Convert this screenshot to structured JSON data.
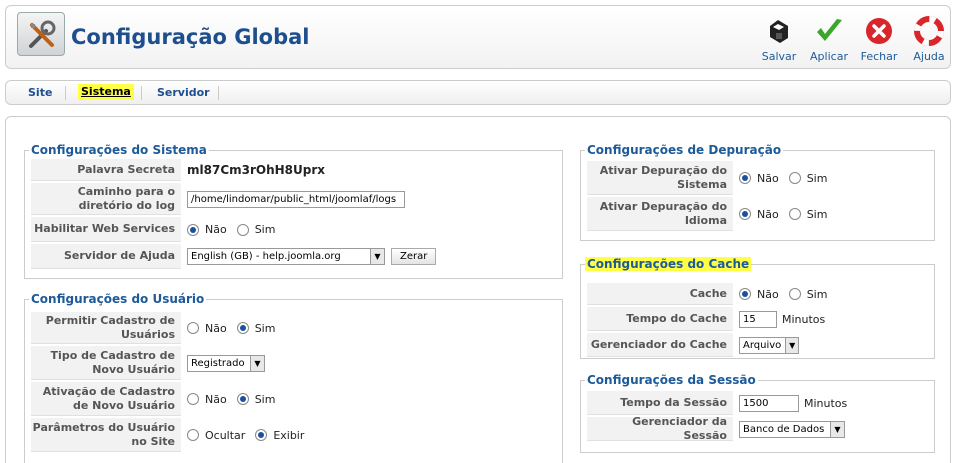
{
  "header": {
    "title": "Configuração Global",
    "toolbar": [
      {
        "label": "Salvar",
        "icon": "save-icon"
      },
      {
        "label": "Aplicar",
        "icon": "apply-check-icon"
      },
      {
        "label": "Fechar",
        "icon": "close-icon"
      },
      {
        "label": "Ajuda",
        "icon": "help-lifebuoy-icon"
      }
    ]
  },
  "submenu": {
    "tabs": [
      {
        "label": "Site"
      },
      {
        "label": "Sistema",
        "active": true
      },
      {
        "label": "Servidor"
      }
    ]
  },
  "sistema": {
    "legend": "Configurações do Sistema",
    "palavra_secreta": {
      "label": "Palavra Secreta",
      "value": "ml87Cm3rOhH8Uprx"
    },
    "log_path": {
      "label": "Caminho para o diretório do log",
      "value": "/home/lindomar/public_html/joomlaf/logs"
    },
    "web_services": {
      "label": "Habilitar Web Services",
      "opt_no": "Não",
      "opt_yes": "Sim",
      "selected": "Não"
    },
    "help_server": {
      "label": "Servidor de Ajuda",
      "value": "English (GB) - help.joomla.org",
      "reset_label": "Zerar"
    }
  },
  "usuario": {
    "legend": "Configurações do Usuário",
    "cadastro": {
      "label": "Permitir Cadastro de Usuários",
      "opt_no": "Não",
      "opt_yes": "Sim",
      "selected": "Sim"
    },
    "tipo": {
      "label": "Tipo de Cadastro de Novo Usuário",
      "value": "Registrado"
    },
    "ativacao": {
      "label": "Ativação de Cadastro de Novo Usuário",
      "opt_no": "Não",
      "opt_yes": "Sim",
      "selected": "Sim"
    },
    "parametros": {
      "label": "Parâmetros do Usuário no Site",
      "opt_hide": "Ocultar",
      "opt_show": "Exibir",
      "selected": "Exibir"
    }
  },
  "depuracao": {
    "legend": "Configurações de Depuração",
    "sistema": {
      "label": "Ativar Depuração do Sistema",
      "opt_no": "Não",
      "opt_yes": "Sim",
      "selected": "Não"
    },
    "idioma": {
      "label": "Ativar Depuração do Idioma",
      "opt_no": "Não",
      "opt_yes": "Sim",
      "selected": "Não"
    }
  },
  "cache": {
    "legend": "Configurações do Cache",
    "cache": {
      "label": "Cache",
      "opt_no": "Não",
      "opt_yes": "Sim",
      "selected": "Não"
    },
    "tempo": {
      "label": "Tempo do Cache",
      "value": "15",
      "unit": "Minutos"
    },
    "gerenciador": {
      "label": "Gerenciador do Cache",
      "value": "Arquivo"
    }
  },
  "sessao": {
    "legend": "Configurações da Sessão",
    "tempo": {
      "label": "Tempo da Sessão",
      "value": "1500",
      "unit": "Minutos"
    },
    "gerenciador": {
      "label": "Gerenciador da Sessão",
      "value": "Banco de Dados"
    }
  }
}
